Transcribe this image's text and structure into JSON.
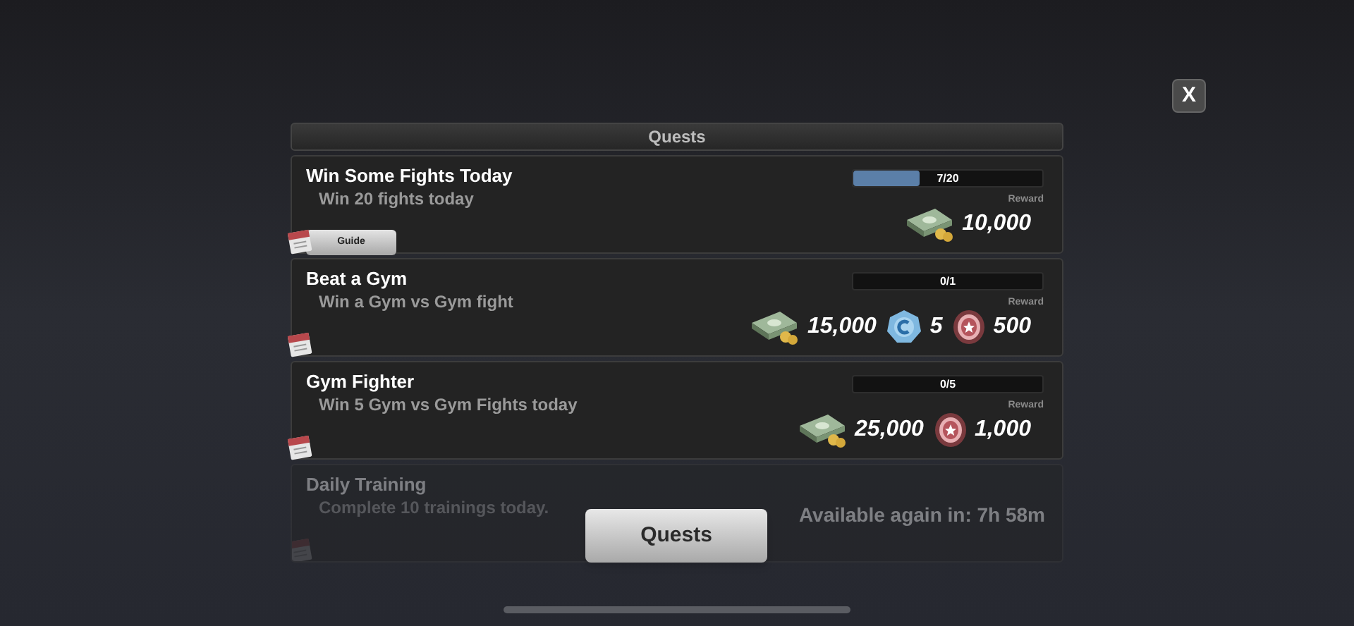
{
  "close_button": {
    "label": "X"
  },
  "header": {
    "title": "Quests"
  },
  "quests": [
    {
      "title": "Win Some Fights Today",
      "description": "Win 20 fights today",
      "available": true,
      "progress": {
        "text": "7/20",
        "level": 0.35
      },
      "reward_label": "Reward",
      "rewards": [
        {
          "kind": "money",
          "amount": "10,000"
        }
      ],
      "guide": "Guide"
    },
    {
      "title": "Beat a Gym",
      "description": "Win a Gym vs Gym fight",
      "available": true,
      "progress": {
        "text": "0/1",
        "level": 0
      },
      "reward_label": "Reward",
      "rewards": [
        {
          "kind": "money",
          "amount": "15,000"
        },
        {
          "kind": "credit",
          "amount": "5"
        },
        {
          "kind": "token",
          "amount": "500"
        }
      ]
    },
    {
      "title": "Gym Fighter",
      "description": "Win 5 Gym vs Gym Fights today",
      "available": true,
      "progress": {
        "text": "0/5",
        "level": 0
      },
      "reward_label": "Reward",
      "rewards": [
        {
          "kind": "money",
          "amount": "25,000"
        },
        {
          "kind": "token",
          "amount": "1,000"
        }
      ]
    },
    {
      "title": "Daily Training",
      "description": "Complete 10 trainings today.",
      "available": false,
      "cooldown": "Available again in:  7h 58m"
    }
  ],
  "bottom_button": {
    "label": "Quests"
  }
}
